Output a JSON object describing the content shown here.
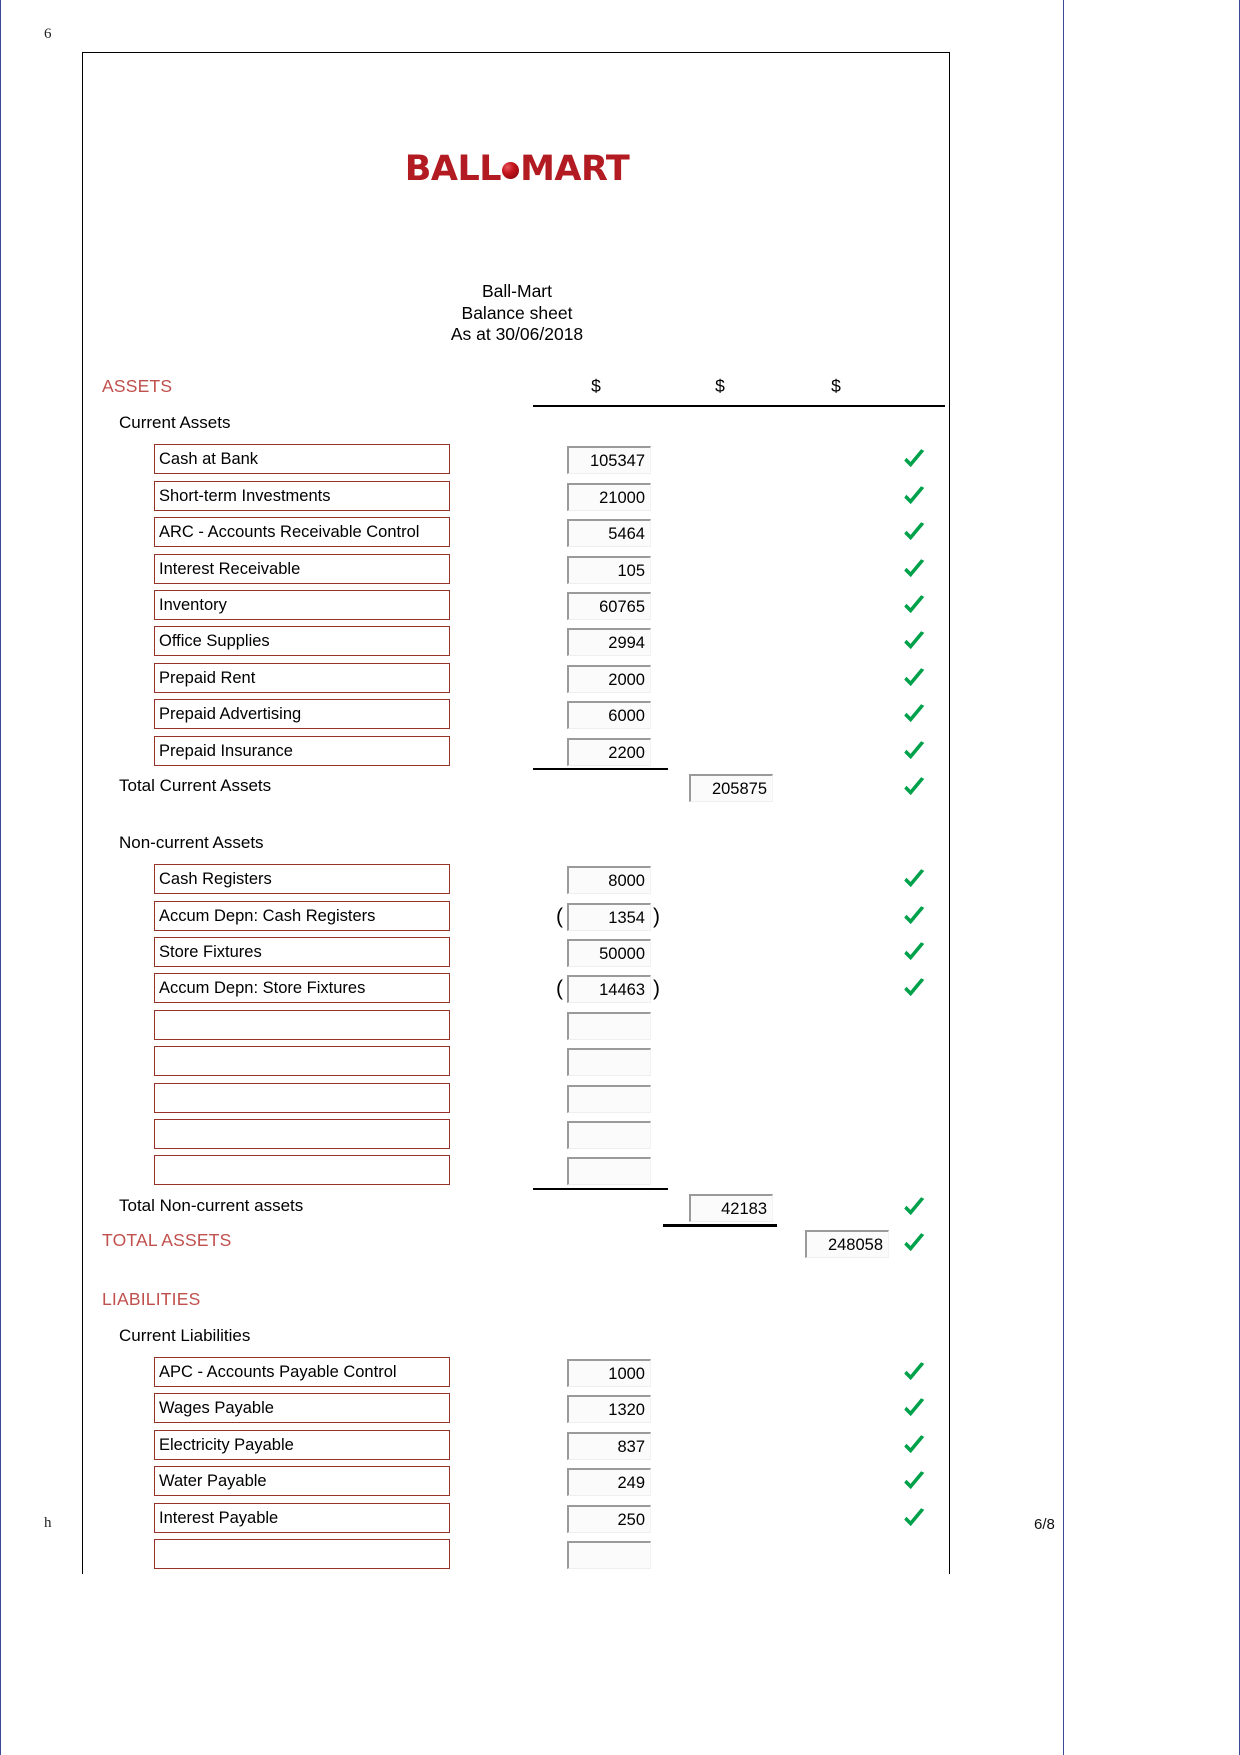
{
  "viewer": {
    "top_edge_mark": "6",
    "bottom_edge_mark": "h",
    "page_number": "6/8"
  },
  "logo": {
    "left_text": "BALL",
    "right_text": "MART",
    "dot": "logo-dot",
    "color": "#b31b22"
  },
  "report": {
    "company": "Ball-Mart",
    "statement": "Balance sheet",
    "as_at": "As at 30/06/2018"
  },
  "colors": {
    "heading_red": "#c0504d",
    "input_border_red": "#963228",
    "tick_green": "#00a14b"
  },
  "columns": {
    "dollar_1": "$",
    "dollar_2": "$",
    "dollar_3": "$"
  },
  "sections": {
    "assets_heading": "ASSETS",
    "current_assets_heading": "Current Assets",
    "noncurrent_assets_heading": "Non-current Assets",
    "total_current_assets_label": "Total Current Assets",
    "total_noncurrent_assets_label": "Total Non-current assets",
    "total_assets_label": "TOTAL ASSETS",
    "liabilities_heading": "LIABILITIES",
    "current_liabilities_heading": "Current Liabilities"
  },
  "current_assets": [
    {
      "name": "Cash at Bank",
      "value": "105347",
      "tick": true
    },
    {
      "name": "Short-term Investments",
      "value": "21000",
      "tick": true
    },
    {
      "name": "ARC - Accounts Receivable Control",
      "value": "5464",
      "tick": true
    },
    {
      "name": "Interest Receivable",
      "value": "105",
      "tick": true
    },
    {
      "name": "Inventory",
      "value": "60765",
      "tick": true
    },
    {
      "name": "Office Supplies",
      "value": "2994",
      "tick": true
    },
    {
      "name": "Prepaid Rent",
      "value": "2000",
      "tick": true
    },
    {
      "name": "Prepaid Advertising",
      "value": "6000",
      "tick": true
    },
    {
      "name": "Prepaid Insurance",
      "value": "2200",
      "tick": true
    }
  ],
  "total_current_assets": {
    "value": "205875",
    "tick": true
  },
  "noncurrent_assets": [
    {
      "name": "Cash Registers",
      "value": "8000",
      "negative": false,
      "tick": true
    },
    {
      "name": "Accum Depn: Cash Registers",
      "value": "1354",
      "negative": true,
      "tick": true
    },
    {
      "name": "Store Fixtures",
      "value": "50000",
      "negative": false,
      "tick": true
    },
    {
      "name": "Accum Depn: Store Fixtures",
      "value": "14463",
      "negative": true,
      "tick": true
    },
    {
      "name": "",
      "value": "",
      "negative": false,
      "tick": false
    },
    {
      "name": "",
      "value": "",
      "negative": false,
      "tick": false
    },
    {
      "name": "",
      "value": "",
      "negative": false,
      "tick": false
    },
    {
      "name": "",
      "value": "",
      "negative": false,
      "tick": false
    },
    {
      "name": "",
      "value": "",
      "negative": false,
      "tick": false
    }
  ],
  "total_noncurrent_assets": {
    "value": "42183",
    "tick": true
  },
  "total_assets": {
    "value": "248058",
    "tick": true
  },
  "current_liabilities": [
    {
      "name": "APC - Accounts Payable Control",
      "value": "1000",
      "tick": true
    },
    {
      "name": "Wages Payable",
      "value": "1320",
      "tick": true
    },
    {
      "name": "Electricity Payable",
      "value": "837",
      "tick": true
    },
    {
      "name": "Water Payable",
      "value": "249",
      "tick": true
    },
    {
      "name": "Interest Payable",
      "value": "250",
      "tick": true
    },
    {
      "name": "",
      "value": "",
      "tick": false
    }
  ]
}
